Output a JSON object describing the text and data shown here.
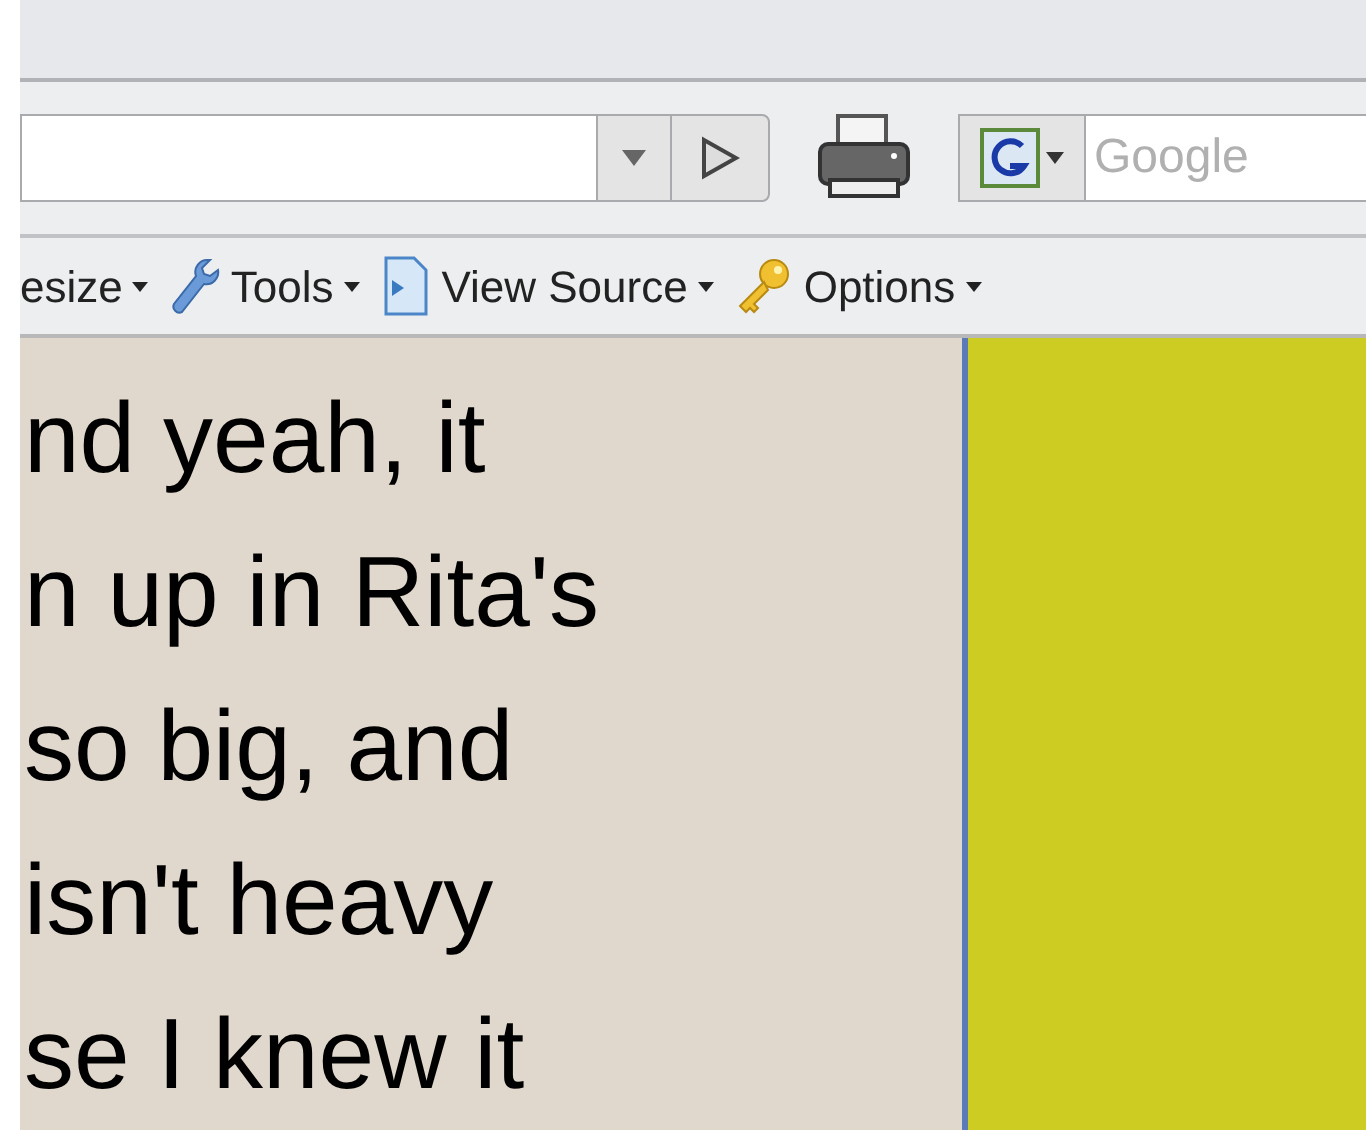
{
  "search": {
    "placeholder": "Google"
  },
  "toolbar": [
    {
      "label": "esize",
      "kind": "plain"
    },
    {
      "label": "Tools",
      "kind": "wrench"
    },
    {
      "label": "View Source",
      "kind": "page"
    },
    {
      "label": "Options",
      "kind": "key"
    }
  ],
  "content": {
    "lines": [
      "nd yeah, it",
      "n up in Rita's",
      "so big, and",
      "isn't heavy",
      "se I knew it"
    ]
  }
}
